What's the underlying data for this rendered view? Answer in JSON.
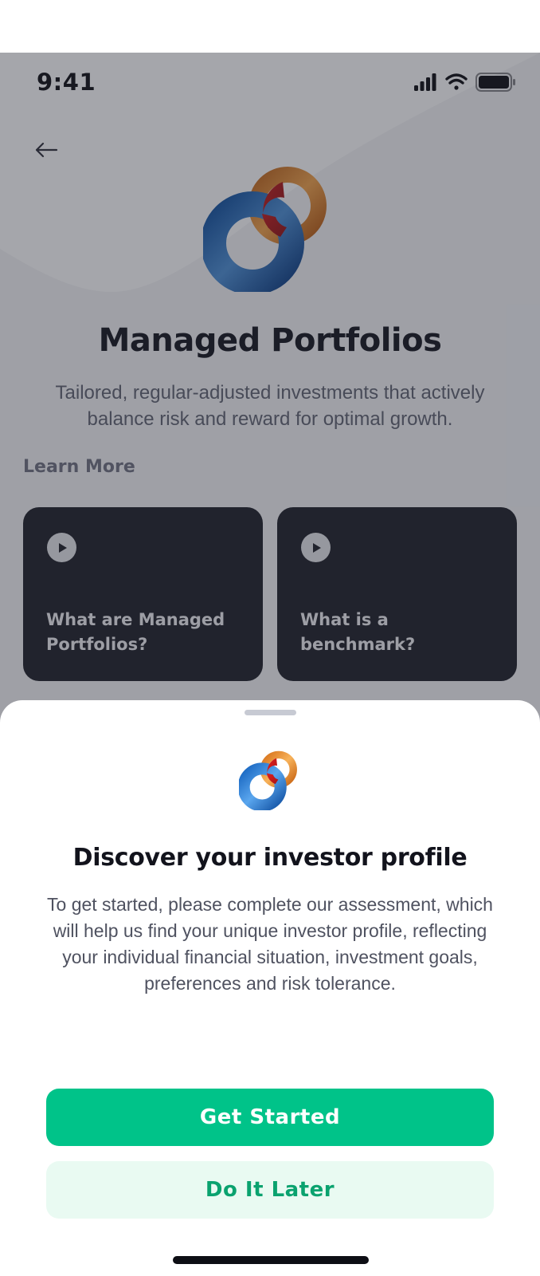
{
  "status_bar": {
    "time": "9:41",
    "icons": [
      "cellular-signal-icon",
      "wifi-icon",
      "battery-icon"
    ]
  },
  "background_screen": {
    "back_icon": "arrow-left-icon",
    "title": "Managed Portfolios",
    "subtitle": "Tailored, regular-adjusted investments that actively balance risk and reward for optimal growth.",
    "learn_more_label": "Learn More",
    "videos": [
      {
        "title": "What are Managed Portfolios?",
        "icon": "play-icon"
      },
      {
        "title": "What is a benchmark?",
        "icon": "play-icon"
      }
    ]
  },
  "sheet": {
    "logo": "rings-logo",
    "title": "Discover your investor profile",
    "body": "To get started, please complete our assessment, which will help us find your unique investor profile, reflecting your individual financial situation, investment goals, preferences and risk tolerance.",
    "primary_button": "Get Started",
    "secondary_button": "Do It Later"
  },
  "colors": {
    "accent": "#00c389",
    "accent_light": "#e9faf2",
    "accent_text": "#0aa26f",
    "card_bg": "#1d1e26",
    "text_dark": "#12131c"
  }
}
